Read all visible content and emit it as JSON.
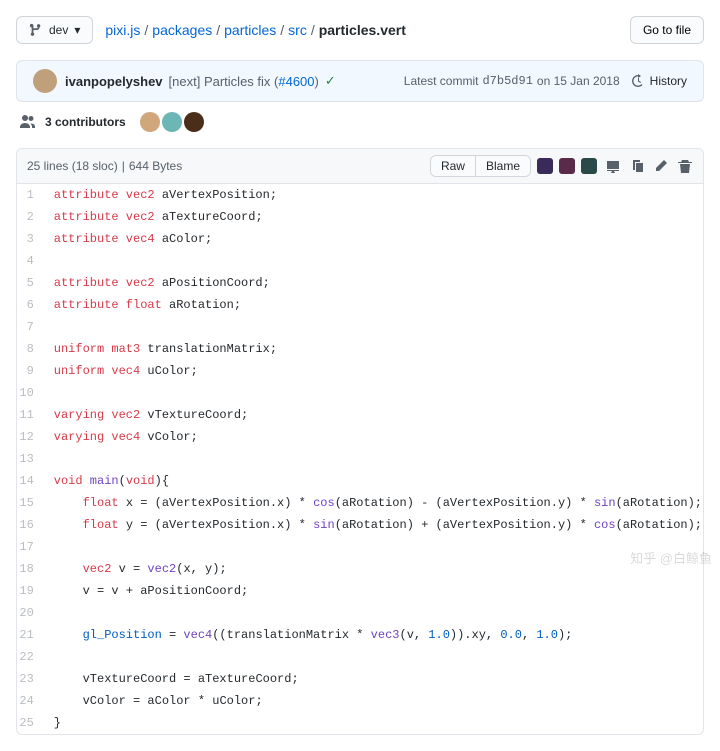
{
  "branch": {
    "label": "dev"
  },
  "breadcrumb": {
    "parts": [
      "pixi.js",
      "packages",
      "particles",
      "src"
    ],
    "current": "particles.vert"
  },
  "gotofile": "Go to file",
  "commit": {
    "author": "ivanpopelyshev",
    "message_prefix": "[next] Particles fix (",
    "issue": "#4600",
    "message_suffix": ")",
    "latest_label": "Latest commit",
    "hash": "d7b5d91",
    "date": "on 15 Jan 2018",
    "history_label": "History"
  },
  "contributors": {
    "count_label": "3 contributors"
  },
  "file_meta": {
    "lines": "25 lines (18 sloc)",
    "size": "644 Bytes"
  },
  "actions": {
    "raw": "Raw",
    "blame": "Blame"
  },
  "code": [
    [
      [
        "kw",
        "attribute"
      ],
      [
        "sp",
        " "
      ],
      [
        "ty",
        "vec2"
      ],
      [
        "sp",
        " "
      ],
      [
        "va",
        "aVertexPosition"
      ],
      [
        "op",
        ";"
      ]
    ],
    [
      [
        "kw",
        "attribute"
      ],
      [
        "sp",
        " "
      ],
      [
        "ty",
        "vec2"
      ],
      [
        "sp",
        " "
      ],
      [
        "va",
        "aTextureCoord"
      ],
      [
        "op",
        ";"
      ]
    ],
    [
      [
        "kw",
        "attribute"
      ],
      [
        "sp",
        " "
      ],
      [
        "ty",
        "vec4"
      ],
      [
        "sp",
        " "
      ],
      [
        "va",
        "aColor"
      ],
      [
        "op",
        ";"
      ]
    ],
    [],
    [
      [
        "kw",
        "attribute"
      ],
      [
        "sp",
        " "
      ],
      [
        "ty",
        "vec2"
      ],
      [
        "sp",
        " "
      ],
      [
        "va",
        "aPositionCoord"
      ],
      [
        "op",
        ";"
      ]
    ],
    [
      [
        "kw",
        "attribute"
      ],
      [
        "sp",
        " "
      ],
      [
        "ty",
        "float"
      ],
      [
        "sp",
        " "
      ],
      [
        "va",
        "aRotation"
      ],
      [
        "op",
        ";"
      ]
    ],
    [],
    [
      [
        "kw",
        "uniform"
      ],
      [
        "sp",
        " "
      ],
      [
        "ty",
        "mat3"
      ],
      [
        "sp",
        " "
      ],
      [
        "va",
        "translationMatrix"
      ],
      [
        "op",
        ";"
      ]
    ],
    [
      [
        "kw",
        "uniform"
      ],
      [
        "sp",
        " "
      ],
      [
        "ty",
        "vec4"
      ],
      [
        "sp",
        " "
      ],
      [
        "va",
        "uColor"
      ],
      [
        "op",
        ";"
      ]
    ],
    [],
    [
      [
        "kw",
        "varying"
      ],
      [
        "sp",
        " "
      ],
      [
        "ty",
        "vec2"
      ],
      [
        "sp",
        " "
      ],
      [
        "va",
        "vTextureCoord"
      ],
      [
        "op",
        ";"
      ]
    ],
    [
      [
        "kw",
        "varying"
      ],
      [
        "sp",
        " "
      ],
      [
        "ty",
        "vec4"
      ],
      [
        "sp",
        " "
      ],
      [
        "va",
        "vColor"
      ],
      [
        "op",
        ";"
      ]
    ],
    [],
    [
      [
        "ty",
        "void"
      ],
      [
        "sp",
        " "
      ],
      [
        "fn",
        "main"
      ],
      [
        "op",
        "("
      ],
      [
        "ty",
        "void"
      ],
      [
        "op",
        "){"
      ]
    ],
    [
      [
        "sp",
        "    "
      ],
      [
        "ty",
        "float"
      ],
      [
        "sp",
        " "
      ],
      [
        "va",
        "x"
      ],
      [
        "sp",
        " "
      ],
      [
        "op",
        "="
      ],
      [
        "sp",
        " "
      ],
      [
        "op",
        "("
      ],
      [
        "va",
        "aVertexPosition"
      ],
      [
        "op",
        ".x) "
      ],
      [
        "op",
        "*"
      ],
      [
        "sp",
        " "
      ],
      [
        "fn",
        "cos"
      ],
      [
        "op",
        "("
      ],
      [
        "va",
        "aRotation"
      ],
      [
        "op",
        ") "
      ],
      [
        "op",
        "-"
      ],
      [
        "sp",
        " "
      ],
      [
        "op",
        "("
      ],
      [
        "va",
        "aVertexPosition"
      ],
      [
        "op",
        ".y) "
      ],
      [
        "op",
        "*"
      ],
      [
        "sp",
        " "
      ],
      [
        "fn",
        "sin"
      ],
      [
        "op",
        "("
      ],
      [
        "va",
        "aRotation"
      ],
      [
        "op",
        ");"
      ]
    ],
    [
      [
        "sp",
        "    "
      ],
      [
        "ty",
        "float"
      ],
      [
        "sp",
        " "
      ],
      [
        "va",
        "y"
      ],
      [
        "sp",
        " "
      ],
      [
        "op",
        "="
      ],
      [
        "sp",
        " "
      ],
      [
        "op",
        "("
      ],
      [
        "va",
        "aVertexPosition"
      ],
      [
        "op",
        ".x) "
      ],
      [
        "op",
        "*"
      ],
      [
        "sp",
        " "
      ],
      [
        "fn",
        "sin"
      ],
      [
        "op",
        "("
      ],
      [
        "va",
        "aRotation"
      ],
      [
        "op",
        ") "
      ],
      [
        "op",
        "+"
      ],
      [
        "sp",
        " "
      ],
      [
        "op",
        "("
      ],
      [
        "va",
        "aVertexPosition"
      ],
      [
        "op",
        ".y) "
      ],
      [
        "op",
        "*"
      ],
      [
        "sp",
        " "
      ],
      [
        "fn",
        "cos"
      ],
      [
        "op",
        "("
      ],
      [
        "va",
        "aRotation"
      ],
      [
        "op",
        ");"
      ]
    ],
    [],
    [
      [
        "sp",
        "    "
      ],
      [
        "ty",
        "vec2"
      ],
      [
        "sp",
        " "
      ],
      [
        "va",
        "v"
      ],
      [
        "sp",
        " "
      ],
      [
        "op",
        "="
      ],
      [
        "sp",
        " "
      ],
      [
        "fn",
        "vec2"
      ],
      [
        "op",
        "("
      ],
      [
        "va",
        "x"
      ],
      [
        "op",
        ", "
      ],
      [
        "va",
        "y"
      ],
      [
        "op",
        ");"
      ]
    ],
    [
      [
        "sp",
        "    "
      ],
      [
        "va",
        "v"
      ],
      [
        "sp",
        " "
      ],
      [
        "op",
        "="
      ],
      [
        "sp",
        " "
      ],
      [
        "va",
        "v"
      ],
      [
        "sp",
        " "
      ],
      [
        "op",
        "+"
      ],
      [
        "sp",
        " "
      ],
      [
        "va",
        "aPositionCoord"
      ],
      [
        "op",
        ";"
      ]
    ],
    [],
    [
      [
        "sp",
        "    "
      ],
      [
        "bi",
        "gl_Position"
      ],
      [
        "sp",
        " "
      ],
      [
        "op",
        "="
      ],
      [
        "sp",
        " "
      ],
      [
        "fn",
        "vec4"
      ],
      [
        "op",
        "(("
      ],
      [
        "va",
        "translationMatrix"
      ],
      [
        "sp",
        " "
      ],
      [
        "op",
        "*"
      ],
      [
        "sp",
        " "
      ],
      [
        "fn",
        "vec3"
      ],
      [
        "op",
        "("
      ],
      [
        "va",
        "v"
      ],
      [
        "op",
        ", "
      ],
      [
        "nu",
        "1.0"
      ],
      [
        "op",
        ")).xy, "
      ],
      [
        "nu",
        "0.0"
      ],
      [
        "op",
        ", "
      ],
      [
        "nu",
        "1.0"
      ],
      [
        "op",
        ");"
      ]
    ],
    [],
    [
      [
        "sp",
        "    "
      ],
      [
        "va",
        "vTextureCoord"
      ],
      [
        "sp",
        " "
      ],
      [
        "op",
        "="
      ],
      [
        "sp",
        " "
      ],
      [
        "va",
        "aTextureCoord"
      ],
      [
        "op",
        ";"
      ]
    ],
    [
      [
        "sp",
        "    "
      ],
      [
        "va",
        "vColor"
      ],
      [
        "sp",
        " "
      ],
      [
        "op",
        "="
      ],
      [
        "sp",
        " "
      ],
      [
        "va",
        "aColor"
      ],
      [
        "sp",
        " "
      ],
      [
        "op",
        "*"
      ],
      [
        "sp",
        " "
      ],
      [
        "va",
        "uColor"
      ],
      [
        "op",
        ";"
      ]
    ],
    [
      [
        "op",
        "}"
      ]
    ]
  ],
  "watermark": "知乎 @白鲸鱼"
}
